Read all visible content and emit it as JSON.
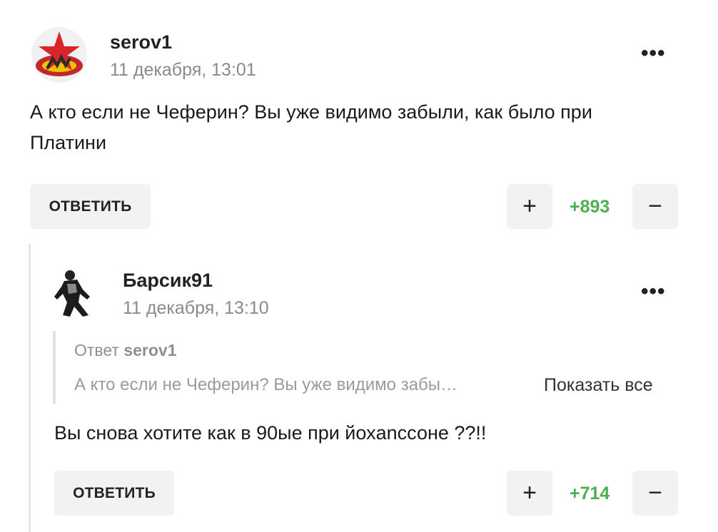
{
  "colors": {
    "score_positive": "#4caf50",
    "button_bg": "#f2f2f2",
    "date": "#8a8a8a"
  },
  "comments": [
    {
      "username": "serov1",
      "date": "11 декабря, 13:01",
      "text_line1": "А кто если не Чеферин? Вы уже видимо забыли, как было при",
      "text_line2": "Платини",
      "reply_label": "ОТВЕТИТЬ",
      "upvote_icon": "+",
      "score": "+893",
      "downvote_icon": "−",
      "more_icon": "•••"
    },
    {
      "username": "Барсик91",
      "date": "11 декабря, 13:10",
      "quote": {
        "prefix": "Ответ",
        "author": "serov1",
        "text": "А кто если не Чеферин? Вы уже видимо забы…",
        "show_all": "Показать все"
      },
      "text_line1": "Вы снова хотите как в 90ые при йохanссоне ??!!",
      "reply_label": "ОТВЕТИТЬ",
      "upvote_icon": "+",
      "score": "+714",
      "downvote_icon": "−",
      "more_icon": "•••"
    }
  ]
}
